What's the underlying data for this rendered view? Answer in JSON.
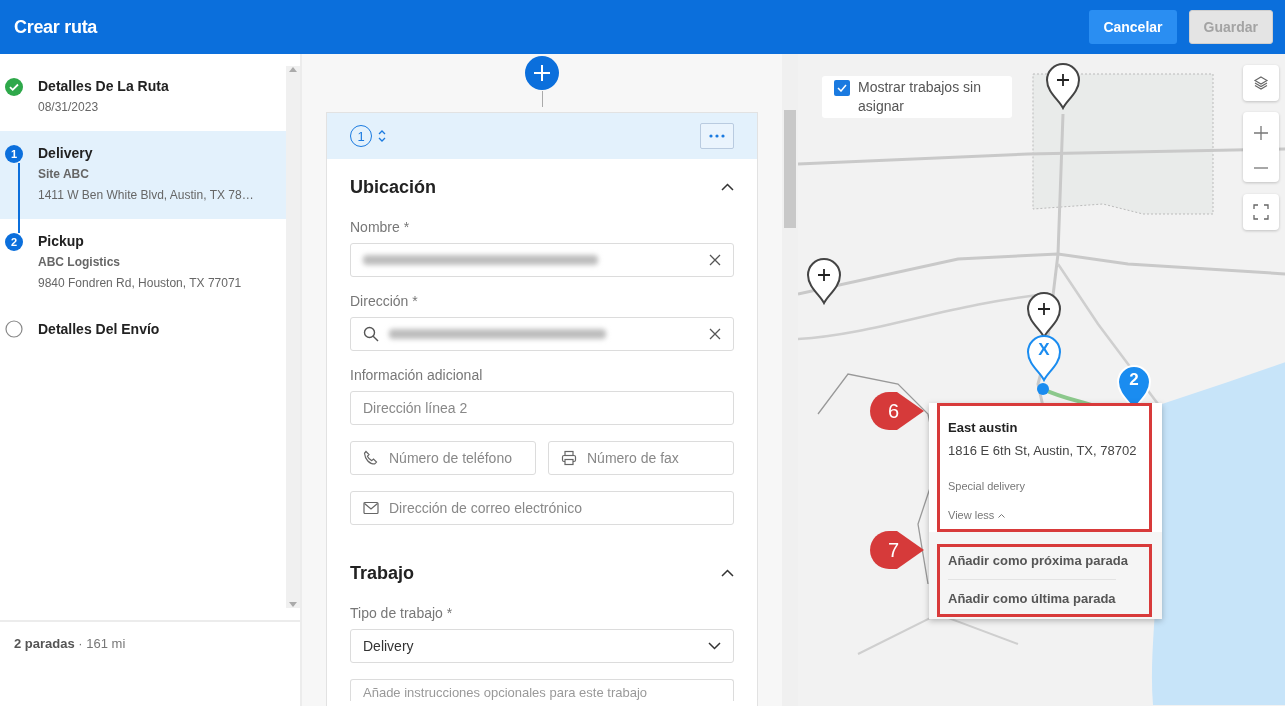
{
  "header": {
    "title": "Crear ruta",
    "buttons": [
      {
        "label": "Cancelar",
        "disabled": false
      },
      {
        "label": "Guardar",
        "disabled": true
      }
    ]
  },
  "sidebar": {
    "steps": [
      {
        "kind": "done",
        "title": "Detalles De La Ruta",
        "lines": [
          "08/31/2023"
        ],
        "selected": false
      },
      {
        "kind": "stop",
        "number": "1",
        "title": "Delivery",
        "lines": [
          "Site ABC",
          "1411 W Ben White Blvd, Austin, TX 78…"
        ],
        "selected": true
      },
      {
        "kind": "stop",
        "number": "2",
        "title": "Pickup",
        "lines": [
          "ABC Logistics",
          "9840 Fondren Rd, Houston, TX 77071"
        ],
        "selected": false
      },
      {
        "kind": "todo",
        "title": "Detalles Del Envío",
        "selected": false
      }
    ],
    "summary": {
      "stops": "2 paradas",
      "separator": "·",
      "distance": "161 mi"
    }
  },
  "form": {
    "stop_number": "1",
    "sections": [
      {
        "title": "Ubicación",
        "expanded": true,
        "fields": [
          {
            "kind": "label",
            "text": "Nombre *"
          },
          {
            "kind": "text",
            "blurred": true,
            "clear": true
          },
          {
            "kind": "label",
            "text": "Dirección *"
          },
          {
            "kind": "search",
            "blurred": true,
            "clear": true
          },
          {
            "kind": "label",
            "text": "Información adicional"
          },
          {
            "kind": "text",
            "placeholder": "Dirección línea 2"
          },
          {
            "kind": "pair",
            "items": [
              {
                "kind": "phone",
                "placeholder": "Número de teléfono"
              },
              {
                "kind": "fax",
                "placeholder": "Número de fax"
              }
            ]
          },
          {
            "kind": "mail",
            "placeholder": "Dirección de correo electrónico"
          }
        ]
      },
      {
        "title": "Trabajo",
        "expanded": true,
        "fields": [
          {
            "kind": "label",
            "text": "Tipo de trabajo *"
          },
          {
            "kind": "select",
            "value": "Delivery"
          },
          {
            "kind": "textarea",
            "placeholder": "Añade instrucciones opcionales para este trabajo"
          }
        ]
      }
    ]
  },
  "map": {
    "show_unassigned": {
      "label": "Mostrar trabajos sin asignar",
      "checked": true
    },
    "markers": [
      {
        "kind": "add"
      },
      {
        "kind": "add"
      },
      {
        "kind": "add"
      },
      {
        "kind": "selected",
        "label": "X"
      },
      {
        "kind": "cluster",
        "label": "2"
      }
    ],
    "popup": {
      "title": "East austin",
      "address": "1816 E 6th St, Austin, TX, 78702",
      "note": "Special delivery",
      "toggle": "View less",
      "actions": [
        "Añadir como próxima parada",
        "Añadir como última parada"
      ]
    },
    "callouts": [
      {
        "number": "6"
      },
      {
        "number": "7"
      }
    ]
  }
}
